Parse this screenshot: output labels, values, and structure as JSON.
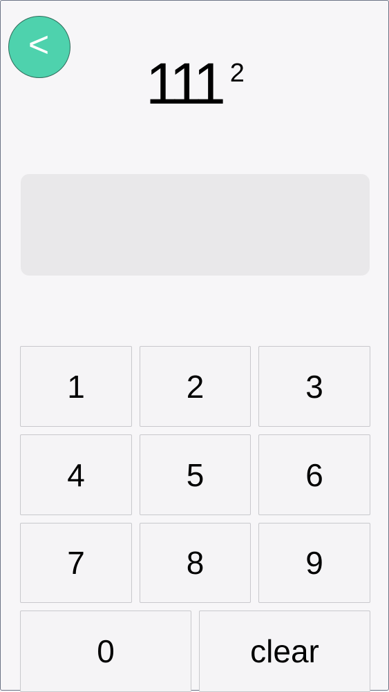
{
  "back_button": {
    "label": "<"
  },
  "problem": {
    "base": "111",
    "exponent": "2"
  },
  "answer": {
    "value": ""
  },
  "keypad": {
    "k1": "1",
    "k2": "2",
    "k3": "3",
    "k4": "4",
    "k5": "5",
    "k6": "6",
    "k7": "7",
    "k8": "8",
    "k9": "9",
    "k0": "0",
    "clear": "clear"
  },
  "colors": {
    "accent": "#4ed2ad",
    "background": "#f7f6f8",
    "answer_box": "#e9e8ea"
  }
}
